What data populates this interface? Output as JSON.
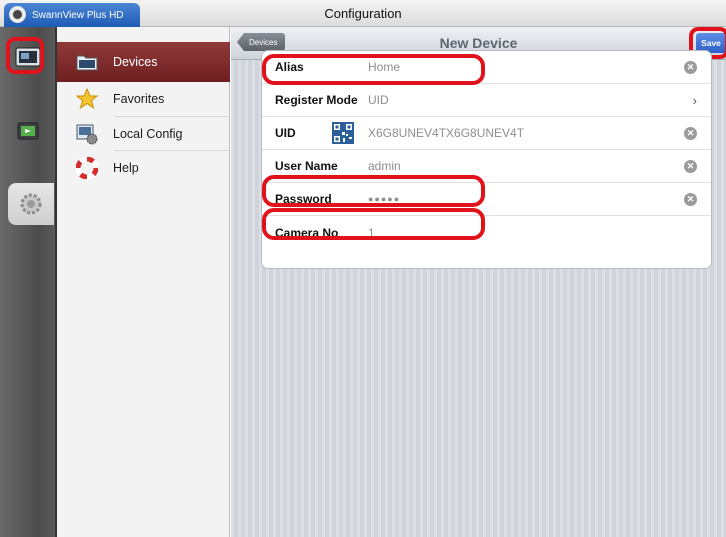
{
  "titlebar": {
    "app_tab": "SwannView Plus HD",
    "title": "Configuration"
  },
  "menu": {
    "items": [
      {
        "label": "Devices",
        "icon": "folder-icon"
      },
      {
        "label": "Favorites",
        "icon": "star-icon"
      },
      {
        "label": "Local Config",
        "icon": "config-icon"
      },
      {
        "label": "Help",
        "icon": "lifebuoy-icon"
      }
    ]
  },
  "navbar": {
    "back_label": "Devices",
    "title": "New Device",
    "save_label": "Save"
  },
  "form": {
    "alias": {
      "label": "Alias",
      "value": "Home"
    },
    "register_mode": {
      "label": "Register Mode",
      "value": "UID"
    },
    "uid": {
      "label": "UID",
      "value": "X6G8UNEV4TX6G8UNEV4T"
    },
    "user_name": {
      "label": "User Name",
      "value": "admin"
    },
    "password": {
      "label": "Password",
      "value": "●●●●●"
    },
    "camera_no": {
      "label": "Camera No",
      "value": "1"
    }
  },
  "colors": {
    "highlight": "#e0121b",
    "active_menu": "#7a2628",
    "accent": "#2c5fc9"
  }
}
